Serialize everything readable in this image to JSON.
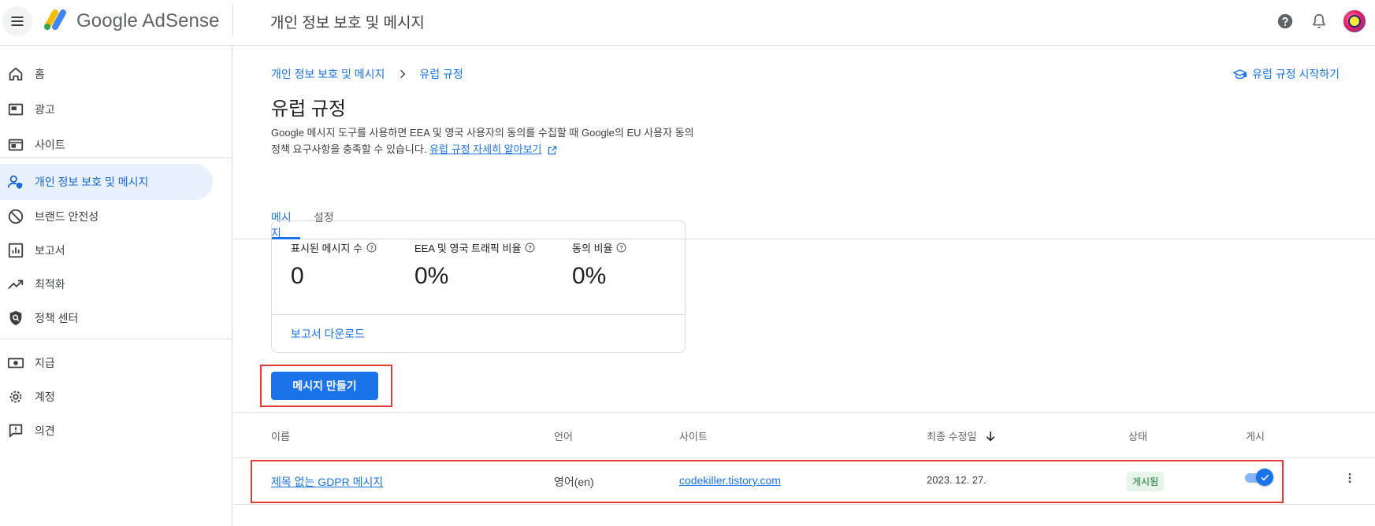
{
  "header": {
    "brand": "Google AdSense",
    "page_heading": "개인 정보 보호 및 메시지"
  },
  "sidebar": {
    "items": [
      {
        "label": "홈",
        "icon": "home-icon"
      },
      {
        "label": "광고",
        "icon": "ads-icon"
      },
      {
        "label": "사이트",
        "icon": "sites-icon"
      },
      {
        "label": "개인 정보 보호 및 메시지",
        "icon": "privacy-icon",
        "active": true
      },
      {
        "label": "브랜드 안전성",
        "icon": "block-icon"
      },
      {
        "label": "보고서",
        "icon": "reports-icon"
      },
      {
        "label": "최적화",
        "icon": "trending-icon"
      },
      {
        "label": "정책 센터",
        "icon": "policy-icon"
      },
      {
        "label": "지급",
        "icon": "payments-icon"
      },
      {
        "label": "계정",
        "icon": "gear-icon"
      },
      {
        "label": "의견",
        "icon": "feedback-icon"
      }
    ]
  },
  "breadcrumb": {
    "parent": "개인 정보 보호 및 메시지",
    "current": "유럽 규정"
  },
  "start_link": "유럽 규정 시작하기",
  "title": "유럽 규정",
  "description": {
    "line1": "Google 메시지 도구를 사용하면 EEA 및 영국 사용자의 동의를 수집할 때 Google의 EU 사용자 동의",
    "line2": "정책 요구사항을 충족할 수 있습니다.",
    "link": "유럽 규정 자세히 알아보기"
  },
  "tabs": [
    {
      "label": "메시지",
      "active": true
    },
    {
      "label": "설정",
      "active": false
    }
  ],
  "stats": {
    "items": [
      {
        "label": "표시된 메시지 수",
        "value": "0"
      },
      {
        "label": "EEA 및 영국 트래픽 비율",
        "value": "0%"
      },
      {
        "label": "동의 비율",
        "value": "0%"
      }
    ],
    "download_link": "보고서 다운로드"
  },
  "create_button": "메시지 만들기",
  "table": {
    "headers": {
      "name": "이름",
      "language": "언어",
      "site": "사이트",
      "modified": "최종 수정일",
      "status": "상태",
      "publish": "게시"
    },
    "rows": [
      {
        "name": "제목 없는 GDPR 메시지",
        "language": "영어(en)",
        "site": "codekiller.tistory.com",
        "modified": "2023. 12. 27.",
        "status": "게시됨",
        "published": true
      }
    ]
  },
  "colors": {
    "accent": "#1a73e8",
    "highlight_border": "#e53935",
    "status_green": "#137333"
  }
}
